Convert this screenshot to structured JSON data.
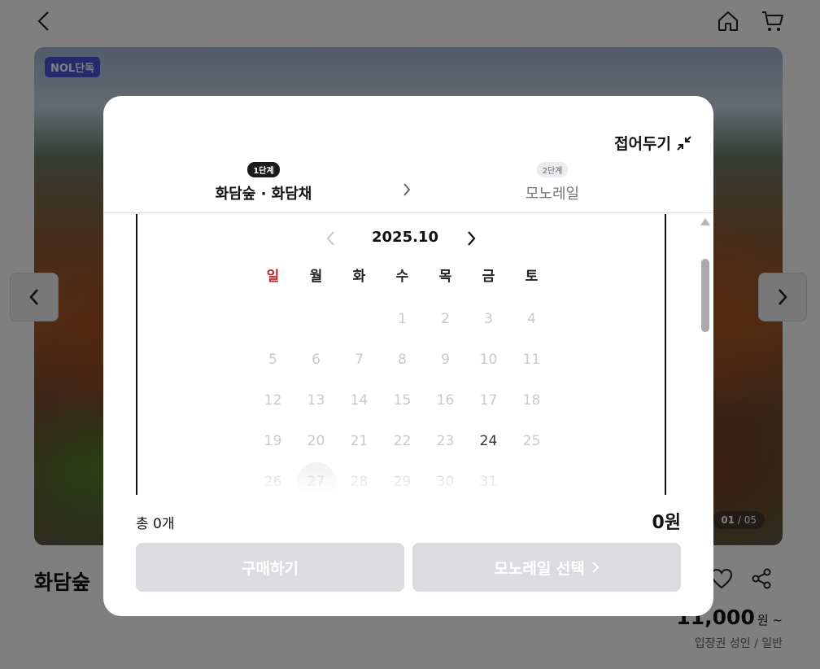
{
  "header": {
    "back_icon": "chevron-left-icon",
    "home_icon": "home-icon",
    "cart_icon": "cart-icon"
  },
  "hero": {
    "badge": "NOL단독",
    "counter_current": "01",
    "counter_sep": "/",
    "counter_total": "05"
  },
  "product": {
    "title": "화담숲",
    "price_number": "11,000",
    "price_unit": "원 ~",
    "price_sub": "입장권 성인 / 일반"
  },
  "modal": {
    "collapse_label": "접어두기",
    "steps": [
      {
        "badge": "1단계",
        "label": "화담숲 · 화담채",
        "active": true
      },
      {
        "badge": "2단계",
        "label": "모노레일",
        "active": false
      }
    ],
    "calendar": {
      "month": "2025.10",
      "weekdays": [
        "일",
        "월",
        "화",
        "수",
        "목",
        "금",
        "토"
      ],
      "leading_blanks": 3,
      "days": [
        "1",
        "2",
        "3",
        "4",
        "5",
        "6",
        "7",
        "8",
        "9",
        "10",
        "11",
        "12",
        "13",
        "14",
        "15",
        "16",
        "17",
        "18",
        "19",
        "20",
        "21",
        "22",
        "23",
        "24",
        "25",
        "26",
        "27",
        "28",
        "29",
        "30",
        "31"
      ],
      "available_days": [
        "24"
      ],
      "highlighted_day": "27"
    },
    "total_count": "총 0개",
    "total_price": "0원",
    "buy_button": "구매하기",
    "next_button": "모노레일 선택"
  },
  "colors": {
    "accent_badge": "#4a55d9",
    "sunday": "#c0242c",
    "disabled_button": "#dcdce0"
  }
}
